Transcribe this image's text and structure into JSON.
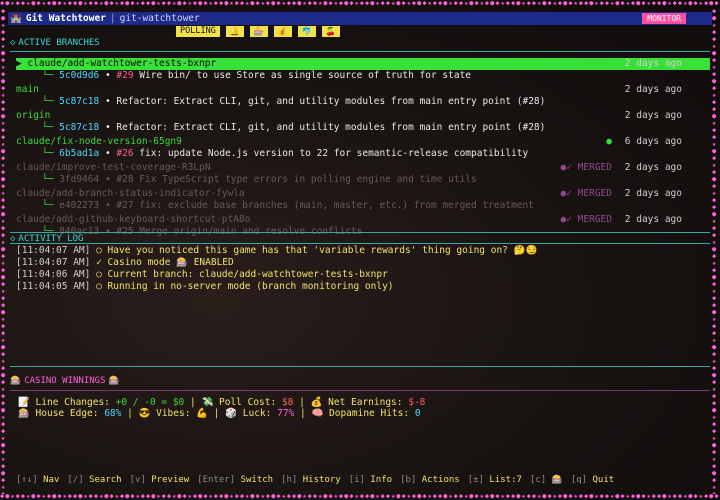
{
  "border_glyphs": "◆●★◆◆★●◆★◆●◆★◆◆●★◆◆★●◆★◆●◆★◆◆●★◆◆★●◆★◆●◆★◆◆●★◆◆★●◆★◆●◆★◆◆●★◆◆★●◆★◆●◆★◆◆●★◆◆★●◆★◆●◆★◆◆●★◆◆★●◆★◆●◆★◆◆●★◆◆★●◆★◆●◆★◆◆●★◆◆★●◆★◆●◆★◆◆●★◆◆★●◆★◆●◆★◆◆●★◆◆★●◆★◆●◆★◆",
  "titlebar": {
    "app": "Git Watchtower",
    "repo": "git-watchtower",
    "mode_badge": "MONITOR"
  },
  "toolbar": {
    "polling": "POLLING",
    "chips": [
      "🔔",
      "🎰",
      "💰",
      "🐬",
      "🍒"
    ]
  },
  "branches": {
    "heading": "ACTIVE BRANCHES",
    "items": [
      {
        "name": "claude/add-watchtower-tests-bxnpr",
        "status": "●★ CURRENT",
        "time": "2 days ago",
        "selected": true,
        "dim": false,
        "hash": "5c0d9d6",
        "pr": "#29",
        "commit": "Wire bin/ to use Store as single source of truth for state"
      },
      {
        "name": "main",
        "status": "",
        "time": "2 days ago",
        "selected": false,
        "dim": false,
        "hash": "5c87c18",
        "pr": "",
        "commit": "Refactor: Extract CLI, git, and utility modules from main entry point (#28)"
      },
      {
        "name": "origin",
        "status": "",
        "time": "2 days ago",
        "selected": false,
        "dim": false,
        "hash": "5c87c18",
        "pr": "",
        "commit": "Refactor: Extract CLI, git, and utility modules from main entry point (#28)"
      },
      {
        "name": "claude/fix-node-version-65gn9",
        "status": "●",
        "time": "6 days ago",
        "selected": false,
        "dim": false,
        "hash": "6b5ad1a",
        "pr": "#26",
        "commit": "fix: update Node.js version to 22 for semantic-release compatibility"
      },
      {
        "name": "claude/improve-test-coverage-R3LpN",
        "status": "●✓ MERGED",
        "time": "2 days ago",
        "selected": false,
        "dim": true,
        "hash": "3fd9464",
        "pr": "#28",
        "commit": "Fix TypeScript type errors in polling engine and time utils"
      },
      {
        "name": "claude/add-branch-status-indicator-fywla",
        "status": "●✓ MERGED",
        "time": "2 days ago",
        "selected": false,
        "dim": true,
        "hash": "e402273",
        "pr": "#27",
        "commit": "fix: exclude base branches (main, master, etc.) from merged treatment"
      },
      {
        "name": "claude/add-github-keyboard-shortcut-ptA8o",
        "status": "●✓ MERGED",
        "time": "2 days ago",
        "selected": false,
        "dim": true,
        "hash": "840ac13",
        "pr": "#25",
        "commit": "Merge origin/main and resolve conflicts"
      }
    ]
  },
  "activity": {
    "heading": "ACTIVITY LOG",
    "entries": [
      {
        "ts": "[11:04:07 AM]",
        "msg": "○ Have you noticed this game has that 'variable rewards' thing going on? 🤔😏"
      },
      {
        "ts": "[11:04:07 AM]",
        "msg": "✓ Casino mode 🎰 ENABLED"
      },
      {
        "ts": "[11:04:06 AM]",
        "msg": "○ Current branch: claude/add-watchtower-tests-bxnpr"
      },
      {
        "ts": "[11:04:05 AM]",
        "msg": "○ Running in no-server mode (branch monitoring only)"
      }
    ]
  },
  "casino": {
    "heading": "CASINO WINNINGS",
    "line1": {
      "lines_label": "📝 Line Changes:",
      "lines_val": "+0 / -0 = $0",
      "poll_label": "💸 Poll Cost:",
      "poll_val": "$8",
      "net_label": "💰 Net Earnings:",
      "net_val": "$-8"
    },
    "line2": {
      "edge_label": "🎰 House Edge:",
      "edge_val": "68%",
      "vibes_label": "😎 Vibes:",
      "vibes_val": "💪",
      "luck_label": "🎲 Luck:",
      "luck_val": "77%",
      "dopa_label": "🧠 Dopamine Hits:",
      "dopa_val": "0"
    }
  },
  "footer": {
    "items": [
      {
        "key": "[↑↓]",
        "label": "Nav"
      },
      {
        "key": "[/]",
        "label": "Search"
      },
      {
        "key": "[v]",
        "label": "Preview"
      },
      {
        "key": "[Enter]",
        "label": "Switch"
      },
      {
        "key": "[h]",
        "label": "History"
      },
      {
        "key": "[i]",
        "label": "Info"
      },
      {
        "key": "[b]",
        "label": "Actions"
      },
      {
        "key": "[±]",
        "label": "List:7"
      },
      {
        "key": "[c]",
        "label": "🎰"
      },
      {
        "key": "[q]",
        "label": "Quit"
      }
    ]
  }
}
